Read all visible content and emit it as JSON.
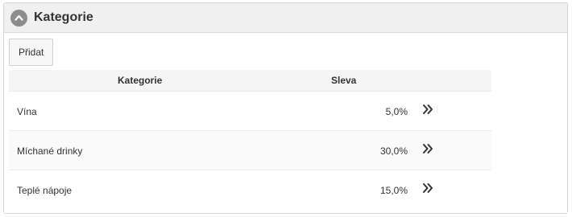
{
  "panel": {
    "title": "Kategorie",
    "collapse_icon": "chevron-up-icon"
  },
  "toolbar": {
    "add_label": "Přidat"
  },
  "table": {
    "columns": [
      "Kategorie",
      "Sleva"
    ],
    "rows": [
      {
        "name": "Vína",
        "discount": "5,0%",
        "action_icon": "double-chevron-right-icon"
      },
      {
        "name": "Míchané drinky",
        "discount": "30,0%",
        "action_icon": "double-chevron-right-icon"
      },
      {
        "name": "Teplé nápoje",
        "discount": "15,0%",
        "action_icon": "double-chevron-right-icon"
      }
    ]
  },
  "colors": {
    "header_bg": "#f0f0f0",
    "icon_bg": "#8c8c8c",
    "text": "#333333"
  }
}
